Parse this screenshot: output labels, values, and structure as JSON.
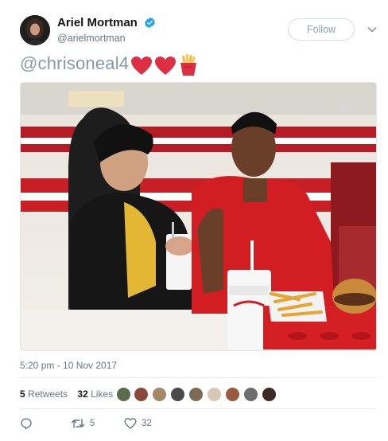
{
  "tweet": {
    "author": {
      "display_name": "Ariel Mortman",
      "handle": "@arielmortman",
      "verified": true,
      "avatar_icon": "profile-photo"
    },
    "follow_label": "Follow",
    "text": "@chrisoneal4",
    "emojis": [
      "red-heart-icon",
      "red-heart-icon",
      "french-fries-icon"
    ],
    "timestamp": "5:20 pm - 10 Nov 2017",
    "stats": {
      "retweets_count": "5",
      "retweets_label": "Retweets",
      "likes_count": "32",
      "likes_label": "Likes"
    },
    "actions": {
      "reply_count": "",
      "retweet_count": "5",
      "like_count": "32"
    },
    "colors": {
      "verified_blue": "#1da1f2",
      "text_gray": "#657786",
      "mention_gray": "#8899a6",
      "heart_red": "#dd2e44"
    }
  }
}
